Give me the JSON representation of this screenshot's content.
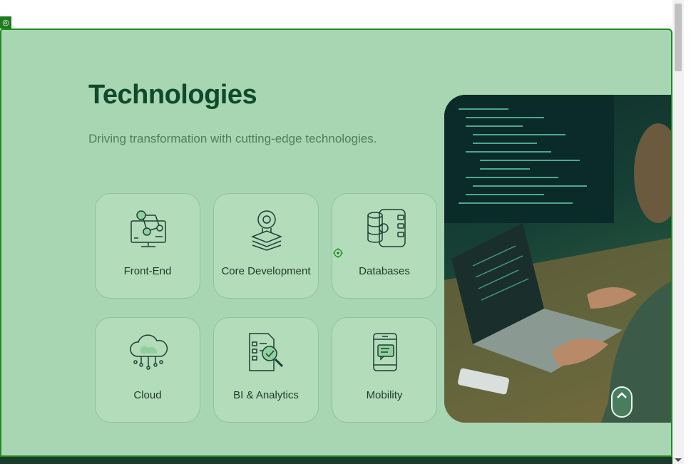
{
  "section": {
    "title": "Technologies",
    "subtitle": "Driving transformation with cutting-edge technologies."
  },
  "cards": [
    {
      "label": "Front-End",
      "icon": "frontend-monitor-icon"
    },
    {
      "label": "Core Development",
      "icon": "lightbulb-gear-icon"
    },
    {
      "label": "Databases",
      "icon": "database-gear-icon"
    },
    {
      "label": "Cloud",
      "icon": "cloud-network-icon"
    },
    {
      "label": "BI & Analytics",
      "icon": "report-magnifier-icon"
    },
    {
      "label": "Mobility",
      "icon": "mobile-chat-icon"
    }
  ],
  "photo": {
    "description_icon": "developer-coding-photo"
  },
  "colors": {
    "section_bg": "#a9d6b2",
    "title": "#0f4a2a",
    "subtitle": "#4f7d5f",
    "card_border": "#8fc39b",
    "icon_stroke": "#1f3f33",
    "accent_green": "#1f8a1f"
  }
}
